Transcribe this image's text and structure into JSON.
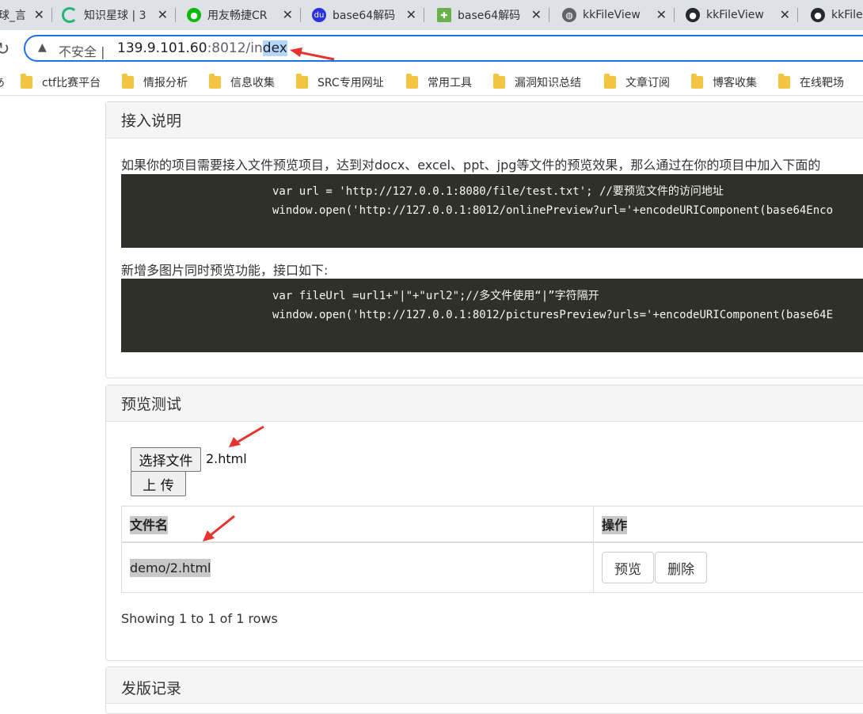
{
  "browser": {
    "tabs": [
      {
        "label": "球_言",
        "icon": "partial-favicon"
      },
      {
        "label": "知识星球 | 3",
        "icon": "spinner-icon"
      },
      {
        "label": "用友畅捷CR",
        "icon": "wechat-icon"
      },
      {
        "label": "base64解码",
        "icon": "baidu-icon"
      },
      {
        "label": "base64解码",
        "icon": "tool-icon"
      },
      {
        "label": "kkFileView",
        "icon": "globe-icon"
      },
      {
        "label": "kkFileView",
        "icon": "github-icon"
      },
      {
        "label": "kkFile",
        "icon": "github-icon"
      }
    ],
    "address": {
      "security_label": "不安全",
      "host": "139.9.101.60",
      "port": ":8012/",
      "path_plain": "in",
      "path_selected": "dex"
    },
    "bookmarks": [
      "ctf比赛平台",
      "情报分析",
      "信息收集",
      "SRC专用网址",
      "常用工具",
      "漏洞知识总结",
      "文章订阅",
      "博客收集",
      "在线靶场"
    ]
  },
  "intro": {
    "title": "接入说明",
    "text1": "如果你的项目需要接入文件预览项目，达到对docx、excel、ppt、jpg等文件的预览效果，那么通过在你的项目中加入下面的",
    "code1_line1": "var url = 'http://127.0.0.1:8080/file/test.txt'; //要预览文件的访问地址",
    "code1_line2": "window.open('http://127.0.0.1:8012/onlinePreview?url='+encodeURIComponent(base64Enco",
    "text2": "新增多图片同时预览功能，接口如下:",
    "code2_line1": "var fileUrl =url1+\"|\"+\"url2\";//多文件使用“|”字符隔开",
    "code2_line2": "window.open('http://127.0.0.1:8012/picturesPreview?urls='+encodeURIComponent(base64E"
  },
  "preview": {
    "title": "预览测试",
    "choose_button": "选择文件",
    "chosen_file": "2.html",
    "upload_button": "上 传",
    "columns": [
      "文件名",
      "操作"
    ],
    "rows": [
      {
        "name": "demo/2.html",
        "preview": "预览",
        "delete": "删除"
      }
    ],
    "footer": "Showing 1 to 1 of 1 rows"
  },
  "release": {
    "title": "发版记录"
  },
  "colors": {
    "accent": "#1a73e8",
    "annotation_arrow": "#e8322d",
    "code_bg": "#2f3129"
  }
}
